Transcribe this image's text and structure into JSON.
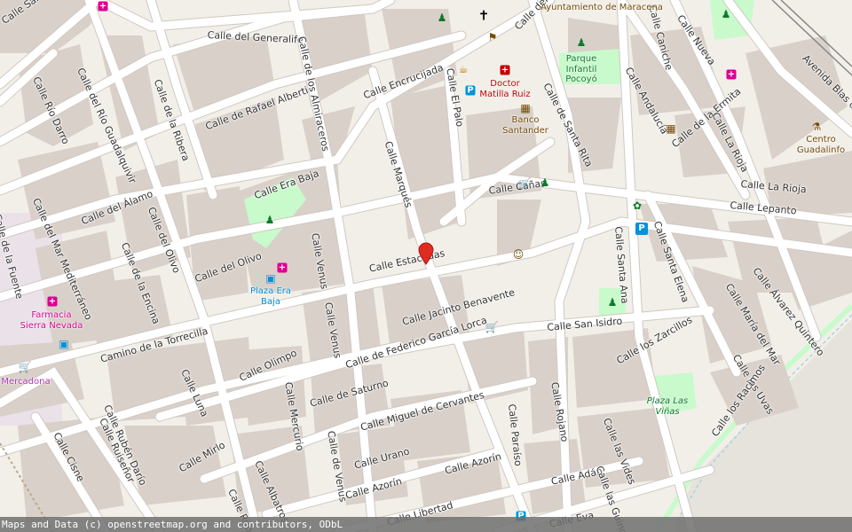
{
  "map": {
    "colors": {
      "background": "#f2efe9",
      "building": "#d9d0c9",
      "road": "#ffffff",
      "road_casing": "#cfc8c2",
      "park": "#c8facc",
      "playground": "#dffce2",
      "retail": "#ffd6d1",
      "railway": "#999999",
      "water_line": "#aad3df",
      "marker": "#e02b20"
    },
    "streets": [
      {
        "name": "Calle San Antonio"
      },
      {
        "name": "Calle del Generalife"
      },
      {
        "name": "Calle de los Almiraceros"
      },
      {
        "name": "Calle del Hospital"
      },
      {
        "name": "Calle Caniche"
      },
      {
        "name": "Calle Nueva"
      },
      {
        "name": "Avenida Blas de Otero"
      },
      {
        "name": "Calle Encrucijada"
      },
      {
        "name": "Calle de Rafael Alberti"
      },
      {
        "name": "Calle Río Darro"
      },
      {
        "name": "Calle del Río Guadalquivir"
      },
      {
        "name": "Calle de la Ribera"
      },
      {
        "name": "Calle de la Ermita"
      },
      {
        "name": "Calle El Palo"
      },
      {
        "name": "Calle de Santa Rita"
      },
      {
        "name": "Calle Andalucía"
      },
      {
        "name": "Calle La Rioja"
      },
      {
        "name": "Calle La Rioja"
      },
      {
        "name": "Calle Era Baja"
      },
      {
        "name": "Calle Marqués"
      },
      {
        "name": "Calle Cañas"
      },
      {
        "name": "Calle Lepanto"
      },
      {
        "name": "Calle del Álamo"
      },
      {
        "name": "Calle del Olivo"
      },
      {
        "name": "Calle de la Fuente"
      },
      {
        "name": "Calle del Mar Mediterráneo"
      },
      {
        "name": "Calle de la Encina"
      },
      {
        "name": "Calle del Olivo"
      },
      {
        "name": "Calle Venus"
      },
      {
        "name": "Calle Estacadas"
      },
      {
        "name": "Calle Santa Ana"
      },
      {
        "name": "Calle Santa Elena"
      },
      {
        "name": "Calle Álvarez Quintero"
      },
      {
        "name": "Calle María del Mar"
      },
      {
        "name": "Calle Jacinto Benavente"
      },
      {
        "name": "Calle San Isidro"
      },
      {
        "name": "Calle Venus"
      },
      {
        "name": "Camino de la Torrecilla"
      },
      {
        "name": "Calle de Federico García Lorca"
      },
      {
        "name": "Calle los Zarcillos"
      },
      {
        "name": "Calle las Uvas"
      },
      {
        "name": "Calle Olimpo"
      },
      {
        "name": "Calle Luna"
      },
      {
        "name": "Calle de Saturno"
      },
      {
        "name": "Calle Mercurio"
      },
      {
        "name": "Calle Rubén Darío"
      },
      {
        "name": "Calle Miguel de Cervantes"
      },
      {
        "name": "Calle Rojano"
      },
      {
        "name": "Calle Paraíso"
      },
      {
        "name": "Calle los Racimos"
      },
      {
        "name": "Calle Ruiseñor"
      },
      {
        "name": "Calle Mirlo"
      },
      {
        "name": "Calle de Venus"
      },
      {
        "name": "Calle las Vides"
      },
      {
        "name": "Calle Cisne"
      },
      {
        "name": "Calle Albatros"
      },
      {
        "name": "Calle Urano"
      },
      {
        "name": "Calle Azorín"
      },
      {
        "name": "Calle Adán"
      },
      {
        "name": "Calle Rubén"
      },
      {
        "name": "Calle Azorín"
      },
      {
        "name": "Calle Libertad"
      },
      {
        "name": "Calle Eva"
      },
      {
        "name": "Calle las Guindas"
      }
    ],
    "pois": [
      {
        "name": "Ayuntamiento de Maracena",
        "icon": "town-hall-icon"
      },
      {
        "name": "Parque Infantil Pocoyó",
        "icon": "playground-icon"
      },
      {
        "name": "Doctor Matilla Ruiz",
        "icon": "pharmacy-icon"
      },
      {
        "name": "Banco Santander",
        "icon": "bank-icon"
      },
      {
        "name": "Centro Guadalinfo",
        "icon": "community-centre-icon"
      },
      {
        "name": "Plaza Era Baja",
        "icon": "bus-stop-icon"
      },
      {
        "name": "Farmacia Sierra Nevada",
        "icon": "pharmacy-icon"
      },
      {
        "name": "Mercadona",
        "icon": "supermarket-icon"
      },
      {
        "name": "Plaza Las Viñas",
        "icon": "park-icon"
      }
    ],
    "attribution": "Maps and Data (c) openstreetmap.org and contributors, ODbL"
  }
}
